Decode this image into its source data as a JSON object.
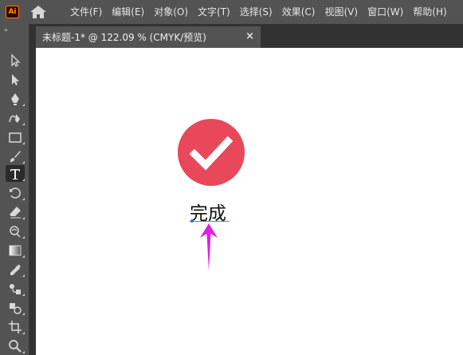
{
  "app": {
    "logo_text": "Ai",
    "accent_color": "#ff9a00"
  },
  "menu": {
    "items": [
      "文件(F)",
      "编辑(E)",
      "对象(O)",
      "文字(T)",
      "选择(S)",
      "效果(C)",
      "视图(V)",
      "窗口(W)",
      "帮助(H)"
    ]
  },
  "toolbar": {
    "grip": "»",
    "tools": [
      {
        "name": "selection-tool",
        "icon": "arrow-outline-icon"
      },
      {
        "name": "direct-selection-tool",
        "icon": "arrow-filled-icon"
      },
      {
        "name": "pen-tool",
        "icon": "pen-icon"
      },
      {
        "name": "curvature-tool",
        "icon": "curvature-pen-icon"
      },
      {
        "name": "rectangle-tool",
        "icon": "rectangle-icon"
      },
      {
        "name": "paintbrush-tool",
        "icon": "brush-icon"
      },
      {
        "name": "type-tool",
        "icon": "type-icon",
        "selected": true
      },
      {
        "name": "rotate-tool",
        "icon": "rotate-icon"
      },
      {
        "name": "eraser-tool",
        "icon": "eraser-icon"
      },
      {
        "name": "warp-tool",
        "icon": "warp-icon"
      },
      {
        "name": "gradient-tool",
        "icon": "gradient-icon"
      },
      {
        "name": "eyedropper-tool",
        "icon": "eyedropper-icon"
      },
      {
        "name": "blend-tool",
        "icon": "blend-icon"
      },
      {
        "name": "shape-builder-tool",
        "icon": "shape-builder-icon"
      },
      {
        "name": "artboard-tool",
        "icon": "artboard-icon"
      },
      {
        "name": "zoom-tool",
        "icon": "zoom-icon"
      }
    ]
  },
  "document": {
    "tab_title": "未标题-1* @ 122.09 % (CMYK/预览)",
    "close_glyph": "×"
  },
  "canvas": {
    "text_content": "完成",
    "check_color": "#e8485a",
    "arrow_color": "#e21ee6"
  }
}
